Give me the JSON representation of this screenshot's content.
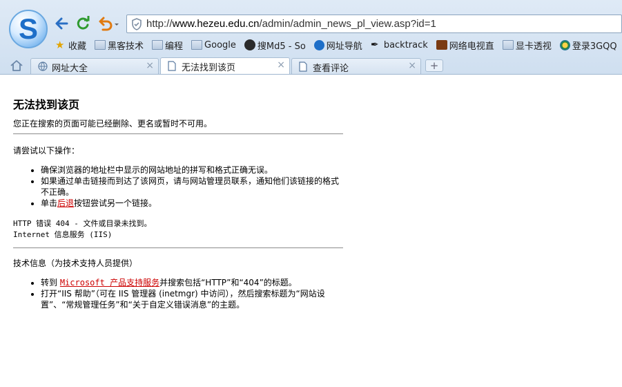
{
  "browser": {
    "address": {
      "url_prefix": "http://",
      "domain": "www.hezeu.edu.cn",
      "path": "/admin/admin_news_pl_view.asp?id=1"
    },
    "bookmarks": [
      "收藏",
      "黑客技术",
      "编程",
      "Google",
      "搜Md5 - So",
      "网址导航",
      "backtrack",
      "网络电视直",
      "显卡透视",
      "登录3GQQ"
    ],
    "tabs": [
      {
        "label": "网址大全",
        "close": "×"
      },
      {
        "label": "无法找到该页",
        "close": "×"
      },
      {
        "label": "查看评论",
        "close": "×"
      }
    ],
    "new_tab": "+",
    "icons": {
      "logo": "sogou-browser-logo",
      "back": "back-arrow-icon",
      "refresh": "refresh-icon",
      "undo": "undo-close-icon",
      "shield": "security-shield-icon",
      "home": "home-icon",
      "page": "page-icon",
      "globe": "globe-icon"
    }
  },
  "page": {
    "title": "无法找到该页",
    "subtitle": "您正在搜索的页面可能已经删除、更名或暂时不可用。",
    "try_heading": "请尝试以下操作：",
    "tips": [
      "确保浏览器的地址栏中显示的网站地址的拼写和格式正确无误。",
      "如果通过单击链接而到达了该网页，请与网站管理员联系，通知他们该链接的格式不正确。"
    ],
    "tip3_prefix": "单击",
    "tip3_link": "后退",
    "tip3_suffix": "按钮尝试另一个链接。",
    "error_line1": "HTTP 错误 404 - 文件或目录未找到。",
    "error_line2": "Internet 信息服务 (IIS)",
    "tech_heading": "技术信息（为技术支持人员提供）",
    "tech1_prefix": "转到 ",
    "tech1_link": "Microsoft 产品支持服务",
    "tech1_suffix": "并搜索包括“HTTP”和“404”的标题。",
    "tech2": "打开“IIS 帮助”（可在 IIS 管理器 (inetmgr) 中访问），然后搜索标题为“网站设置”、“常规管理任务”和“关于自定义错误消息”的主题。"
  },
  "colors": {
    "link": "#cc0000",
    "chrome": "#dfeaf6"
  }
}
